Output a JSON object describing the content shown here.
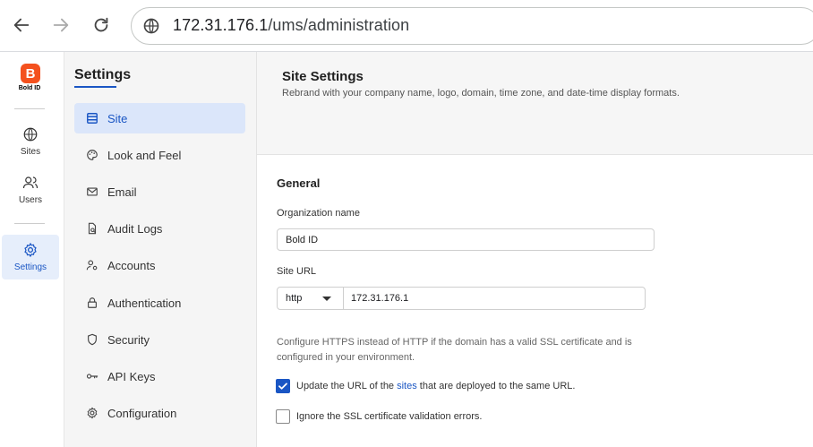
{
  "browser": {
    "url_host": "172.31.176.1",
    "url_path": "/ums/administration"
  },
  "rail": {
    "logo_letter": "B",
    "logo_text": "Bold ID",
    "items": [
      {
        "label": "Sites",
        "icon": "globe-icon"
      },
      {
        "label": "Users",
        "icon": "users-icon"
      },
      {
        "label": "Settings",
        "icon": "gear-icon"
      }
    ],
    "accent": "#f4511e"
  },
  "sidebar": {
    "title": "Settings",
    "items": [
      {
        "label": "Site",
        "icon": "site-list-icon"
      },
      {
        "label": "Look and Feel",
        "icon": "palette-icon"
      },
      {
        "label": "Email",
        "icon": "mail-icon"
      },
      {
        "label": "Audit Logs",
        "icon": "document-search-icon"
      },
      {
        "label": "Accounts",
        "icon": "account-gear-icon"
      },
      {
        "label": "Authentication",
        "icon": "lock-icon"
      },
      {
        "label": "Security",
        "icon": "shield-icon"
      },
      {
        "label": "API Keys",
        "icon": "key-icon"
      },
      {
        "label": "Configuration",
        "icon": "gear-icon"
      }
    ]
  },
  "main": {
    "title": "Site Settings",
    "subtitle": "Rebrand with your company name, logo, domain, time zone, and date-time display formats.",
    "section_title": "General",
    "org_label": "Organization name",
    "org_value": "Bold ID",
    "site_url_label": "Site URL",
    "protocol": "http",
    "site_url_value": "172.31.176.1",
    "help_text": "Configure HTTPS instead of HTTP if the domain has a valid SSL certificate and is configured in your environment.",
    "update_url": {
      "before": "Update the URL of the ",
      "link": "sites",
      "after": " that are deployed to the same URL.",
      "checked": true
    },
    "ignore_ssl": {
      "label": "Ignore the SSL certificate validation errors.",
      "checked": false
    }
  },
  "colors": {
    "primary": "#1a56c4",
    "active_bg": "#dbe6fa"
  }
}
